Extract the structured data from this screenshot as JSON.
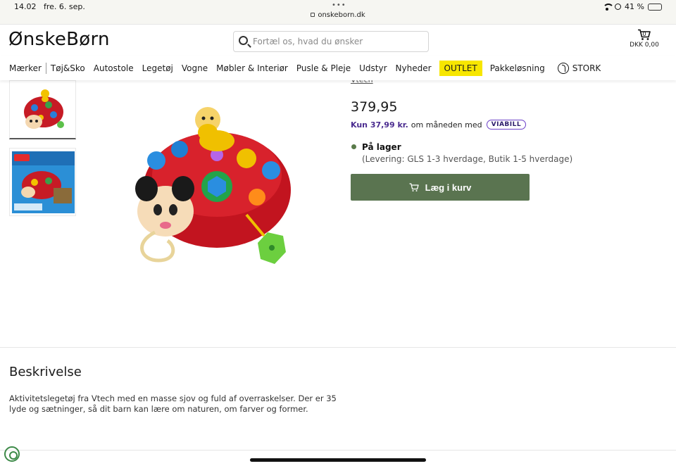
{
  "status_bar": {
    "time": "14.02",
    "date": "fre. 6. sep.",
    "url": "onskeborn.dk",
    "battery": "41 %",
    "battery_level": 0.41
  },
  "header": {
    "logo": "ØnskeBørn",
    "search_placeholder": "Fortæl os, hvad du ønsker",
    "cart_count": "0",
    "cart_total": "DKK 0,00"
  },
  "nav": {
    "items": [
      "Mærker",
      "Tøj&Sko",
      "Autostole",
      "Legetøj",
      "Vogne",
      "Møbler & Interiør",
      "Pusle & Pleje",
      "Udstyr",
      "Nyheder",
      "OUTLET",
      "Pakkeløsning",
      "STORK"
    ]
  },
  "product": {
    "price": "379,95",
    "installment_amount": "Kun 37,99 kr.",
    "installment_text": "om måneden med",
    "installment_provider": "VIABILL",
    "stock_status": "På lager",
    "delivery": "(Levering: GLS 1-3 hverdage, Butik 1-5 hverdage)",
    "add_to_cart": "Læg i kurv"
  },
  "description": {
    "title": "Beskrivelse",
    "text": "Aktivitetslegetøj fra Vtech med en masse sjov og fuld af overraskelser. Der er 35 lyde og sætninger, så dit barn kan lære om naturen, om farver og former."
  },
  "colors": {
    "accent_green": "#5a7450",
    "outlet_yellow": "#f7e600",
    "viabill_purple": "#4a2b8f"
  }
}
